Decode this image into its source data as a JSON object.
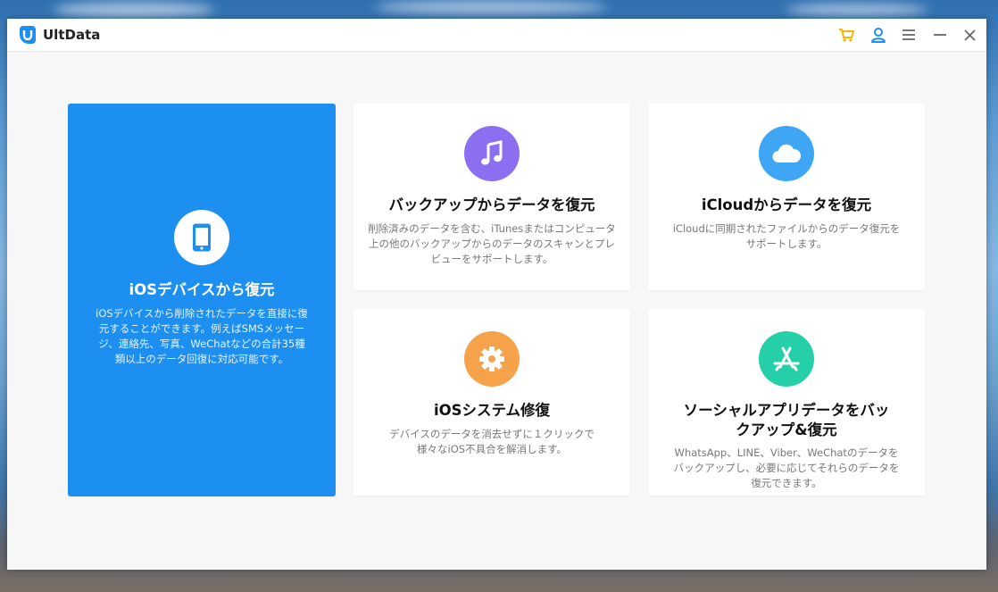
{
  "app": {
    "title": "UltData"
  },
  "titlebar": {
    "icons": [
      "cart-icon",
      "user-icon",
      "menu-icon",
      "minimize-icon",
      "close-icon"
    ]
  },
  "colors": {
    "primary_card": "#1d8ff0",
    "music_icon": "#8c6ff0",
    "cloud_icon": "#3ea6f5",
    "gear_icon": "#f6a24a",
    "appstore_icon": "#25cfa8"
  },
  "cards": [
    {
      "icon": "phone-icon",
      "title": "iOSデバイスから復元",
      "description": "iOSデバイスから削除されたデータを直接に復元することができます。例えばSMSメッセージ、連絡先、写真、WeChatなどの合計35種類以上のデータ回復に対応可能です。"
    },
    {
      "icon": "music-icon",
      "title": "バックアップからデータを復元",
      "description": "削除済みのデータを含む、iTunesまたはコンピュータ上の他のバックアップからのデータのスキャンとプレビューをサポートします。"
    },
    {
      "icon": "cloud-icon",
      "title": "iCloudからデータを復元",
      "description": "iCloudに同期されたファイルからのデータ復元をサポートします。"
    },
    {
      "icon": "gear-icon",
      "title": "iOSシステム修復",
      "description": "デバイスのデータを消去せずに１クリックで様々なiOS不具合を解消します。"
    },
    {
      "icon": "app-store-icon",
      "title": "ソーシャルアプリデータをバックアップ&復元",
      "description": "WhatsApp、LINE、Viber、WeChatのデータをバックアップし、必要に応じてそれらのデータを復元できます。"
    }
  ]
}
